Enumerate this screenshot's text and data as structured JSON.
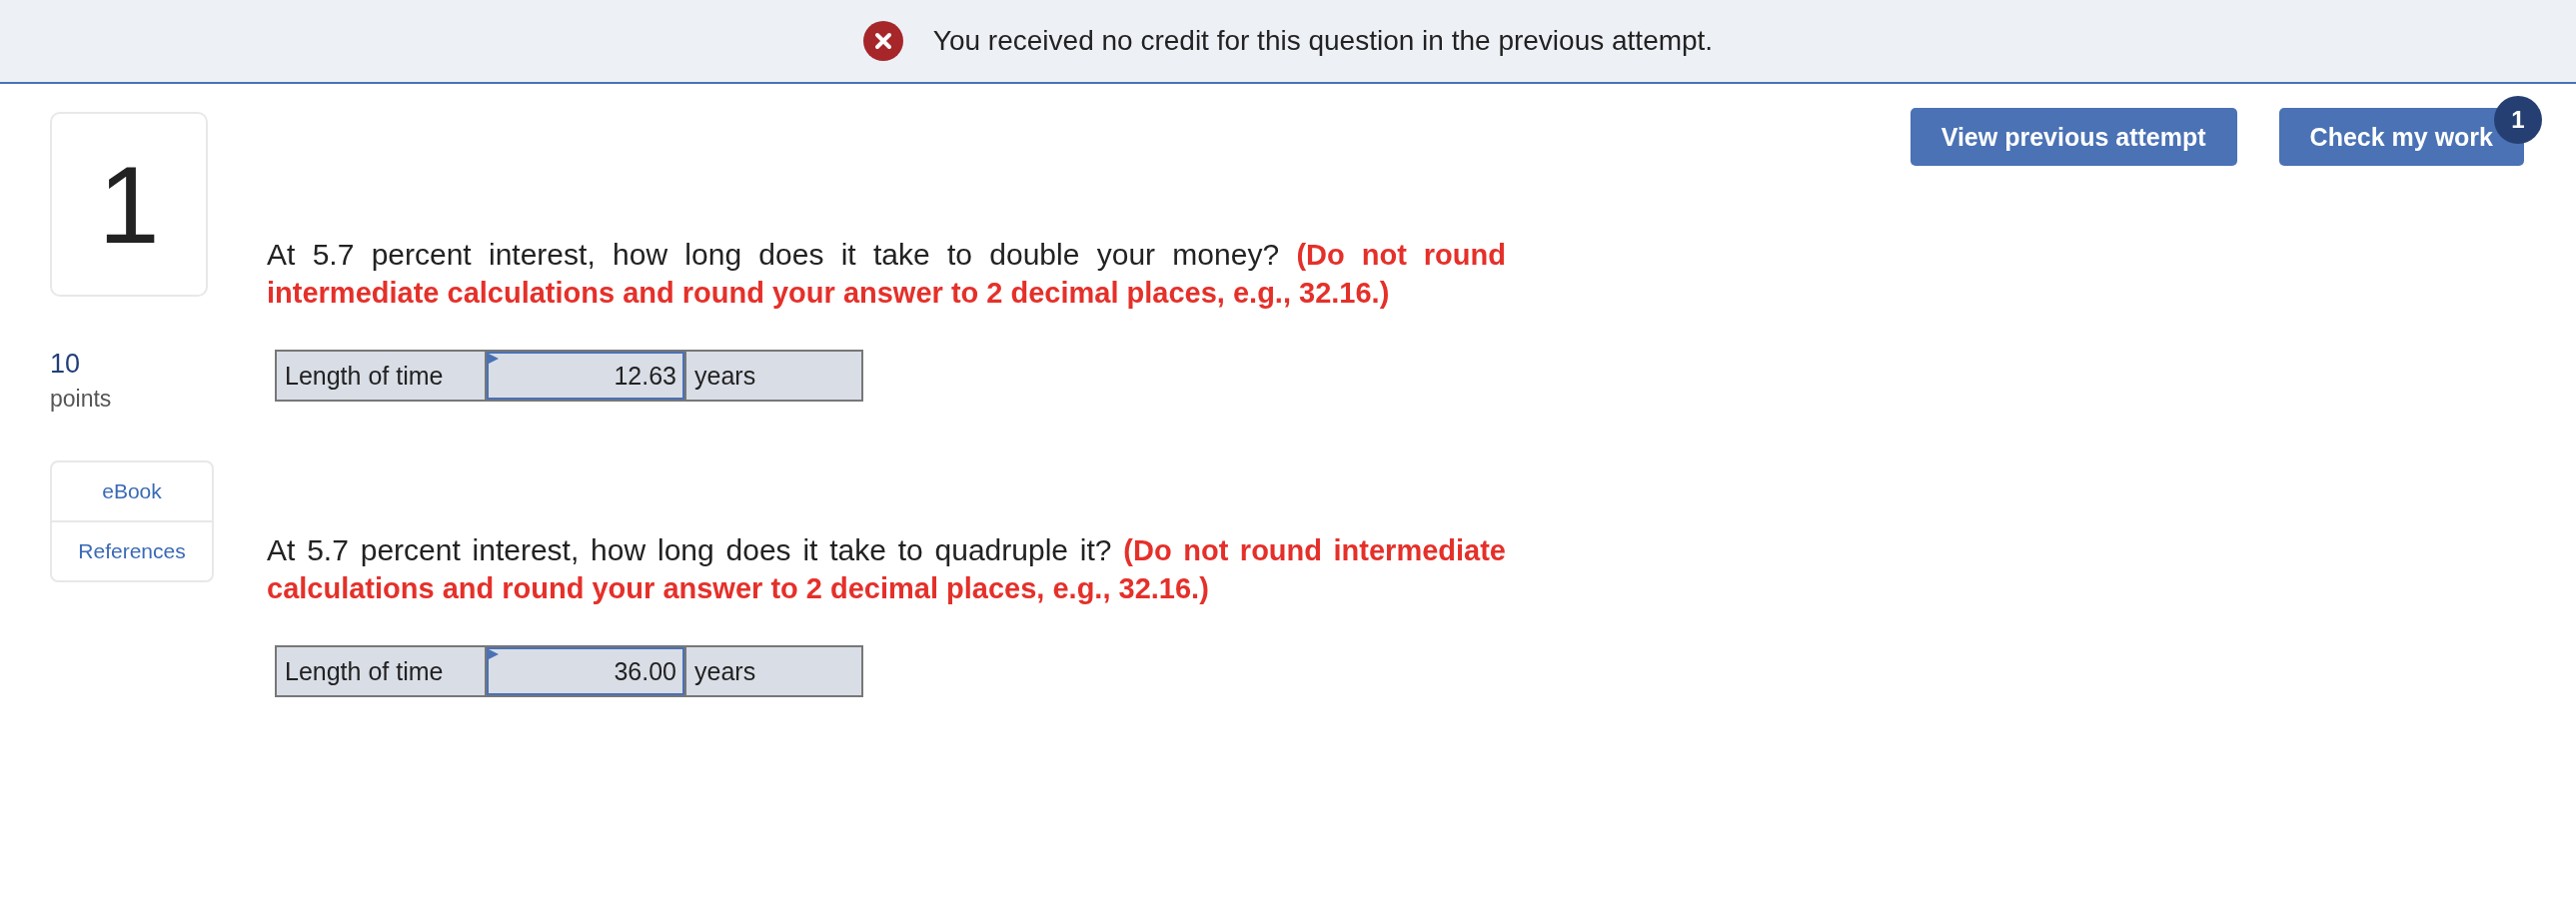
{
  "banner": {
    "kind": "error",
    "message": "You received no credit for this question in the previous attempt."
  },
  "question_number": "1",
  "points": {
    "value": "10",
    "label": "points"
  },
  "resources": [
    {
      "label": "eBook"
    },
    {
      "label": "References"
    }
  ],
  "buttons": [
    {
      "label": "View previous attempt"
    },
    {
      "label": "Check my work",
      "badge": "1"
    }
  ],
  "questions": [
    {
      "text": "At 5.7 percent interest, how long does it take to double your money?",
      "instruction": "(Do not round intermediate calculations and round your answer to 2 decimal places, e.g., 32.16.)",
      "answer": {
        "label": "Length of time",
        "value": "12.63",
        "unit": "years"
      }
    },
    {
      "text": "At 5.7 percent interest, how long does it take to quadruple it?",
      "instruction": "(Do not round intermediate calculations and round your answer to 2 decimal places, e.g., 32.16.)",
      "answer": {
        "label": "Length of time",
        "value": "36.00",
        "unit": "years"
      }
    }
  ]
}
